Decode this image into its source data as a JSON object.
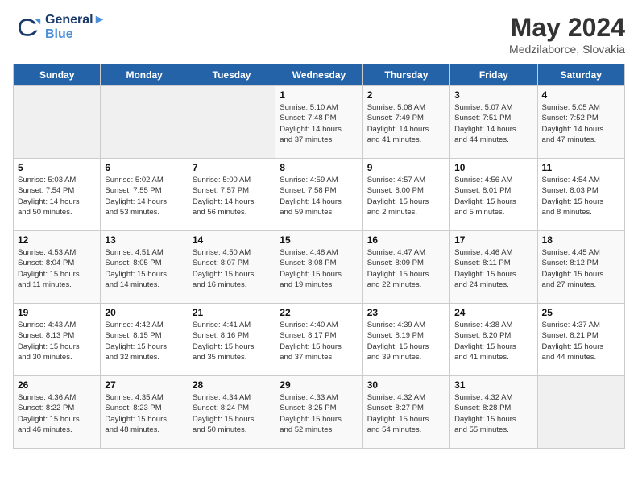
{
  "header": {
    "logo_line1": "General",
    "logo_line2": "Blue",
    "month_year": "May 2024",
    "location": "Medzilaborce, Slovakia"
  },
  "days_of_week": [
    "Sunday",
    "Monday",
    "Tuesday",
    "Wednesday",
    "Thursday",
    "Friday",
    "Saturday"
  ],
  "weeks": [
    [
      {
        "day": "",
        "info": ""
      },
      {
        "day": "",
        "info": ""
      },
      {
        "day": "",
        "info": ""
      },
      {
        "day": "1",
        "info": "Sunrise: 5:10 AM\nSunset: 7:48 PM\nDaylight: 14 hours\nand 37 minutes."
      },
      {
        "day": "2",
        "info": "Sunrise: 5:08 AM\nSunset: 7:49 PM\nDaylight: 14 hours\nand 41 minutes."
      },
      {
        "day": "3",
        "info": "Sunrise: 5:07 AM\nSunset: 7:51 PM\nDaylight: 14 hours\nand 44 minutes."
      },
      {
        "day": "4",
        "info": "Sunrise: 5:05 AM\nSunset: 7:52 PM\nDaylight: 14 hours\nand 47 minutes."
      }
    ],
    [
      {
        "day": "5",
        "info": "Sunrise: 5:03 AM\nSunset: 7:54 PM\nDaylight: 14 hours\nand 50 minutes."
      },
      {
        "day": "6",
        "info": "Sunrise: 5:02 AM\nSunset: 7:55 PM\nDaylight: 14 hours\nand 53 minutes."
      },
      {
        "day": "7",
        "info": "Sunrise: 5:00 AM\nSunset: 7:57 PM\nDaylight: 14 hours\nand 56 minutes."
      },
      {
        "day": "8",
        "info": "Sunrise: 4:59 AM\nSunset: 7:58 PM\nDaylight: 14 hours\nand 59 minutes."
      },
      {
        "day": "9",
        "info": "Sunrise: 4:57 AM\nSunset: 8:00 PM\nDaylight: 15 hours\nand 2 minutes."
      },
      {
        "day": "10",
        "info": "Sunrise: 4:56 AM\nSunset: 8:01 PM\nDaylight: 15 hours\nand 5 minutes."
      },
      {
        "day": "11",
        "info": "Sunrise: 4:54 AM\nSunset: 8:03 PM\nDaylight: 15 hours\nand 8 minutes."
      }
    ],
    [
      {
        "day": "12",
        "info": "Sunrise: 4:53 AM\nSunset: 8:04 PM\nDaylight: 15 hours\nand 11 minutes."
      },
      {
        "day": "13",
        "info": "Sunrise: 4:51 AM\nSunset: 8:05 PM\nDaylight: 15 hours\nand 14 minutes."
      },
      {
        "day": "14",
        "info": "Sunrise: 4:50 AM\nSunset: 8:07 PM\nDaylight: 15 hours\nand 16 minutes."
      },
      {
        "day": "15",
        "info": "Sunrise: 4:48 AM\nSunset: 8:08 PM\nDaylight: 15 hours\nand 19 minutes."
      },
      {
        "day": "16",
        "info": "Sunrise: 4:47 AM\nSunset: 8:09 PM\nDaylight: 15 hours\nand 22 minutes."
      },
      {
        "day": "17",
        "info": "Sunrise: 4:46 AM\nSunset: 8:11 PM\nDaylight: 15 hours\nand 24 minutes."
      },
      {
        "day": "18",
        "info": "Sunrise: 4:45 AM\nSunset: 8:12 PM\nDaylight: 15 hours\nand 27 minutes."
      }
    ],
    [
      {
        "day": "19",
        "info": "Sunrise: 4:43 AM\nSunset: 8:13 PM\nDaylight: 15 hours\nand 30 minutes."
      },
      {
        "day": "20",
        "info": "Sunrise: 4:42 AM\nSunset: 8:15 PM\nDaylight: 15 hours\nand 32 minutes."
      },
      {
        "day": "21",
        "info": "Sunrise: 4:41 AM\nSunset: 8:16 PM\nDaylight: 15 hours\nand 35 minutes."
      },
      {
        "day": "22",
        "info": "Sunrise: 4:40 AM\nSunset: 8:17 PM\nDaylight: 15 hours\nand 37 minutes."
      },
      {
        "day": "23",
        "info": "Sunrise: 4:39 AM\nSunset: 8:19 PM\nDaylight: 15 hours\nand 39 minutes."
      },
      {
        "day": "24",
        "info": "Sunrise: 4:38 AM\nSunset: 8:20 PM\nDaylight: 15 hours\nand 41 minutes."
      },
      {
        "day": "25",
        "info": "Sunrise: 4:37 AM\nSunset: 8:21 PM\nDaylight: 15 hours\nand 44 minutes."
      }
    ],
    [
      {
        "day": "26",
        "info": "Sunrise: 4:36 AM\nSunset: 8:22 PM\nDaylight: 15 hours\nand 46 minutes."
      },
      {
        "day": "27",
        "info": "Sunrise: 4:35 AM\nSunset: 8:23 PM\nDaylight: 15 hours\nand 48 minutes."
      },
      {
        "day": "28",
        "info": "Sunrise: 4:34 AM\nSunset: 8:24 PM\nDaylight: 15 hours\nand 50 minutes."
      },
      {
        "day": "29",
        "info": "Sunrise: 4:33 AM\nSunset: 8:25 PM\nDaylight: 15 hours\nand 52 minutes."
      },
      {
        "day": "30",
        "info": "Sunrise: 4:32 AM\nSunset: 8:27 PM\nDaylight: 15 hours\nand 54 minutes."
      },
      {
        "day": "31",
        "info": "Sunrise: 4:32 AM\nSunset: 8:28 PM\nDaylight: 15 hours\nand 55 minutes."
      },
      {
        "day": "",
        "info": ""
      }
    ]
  ]
}
